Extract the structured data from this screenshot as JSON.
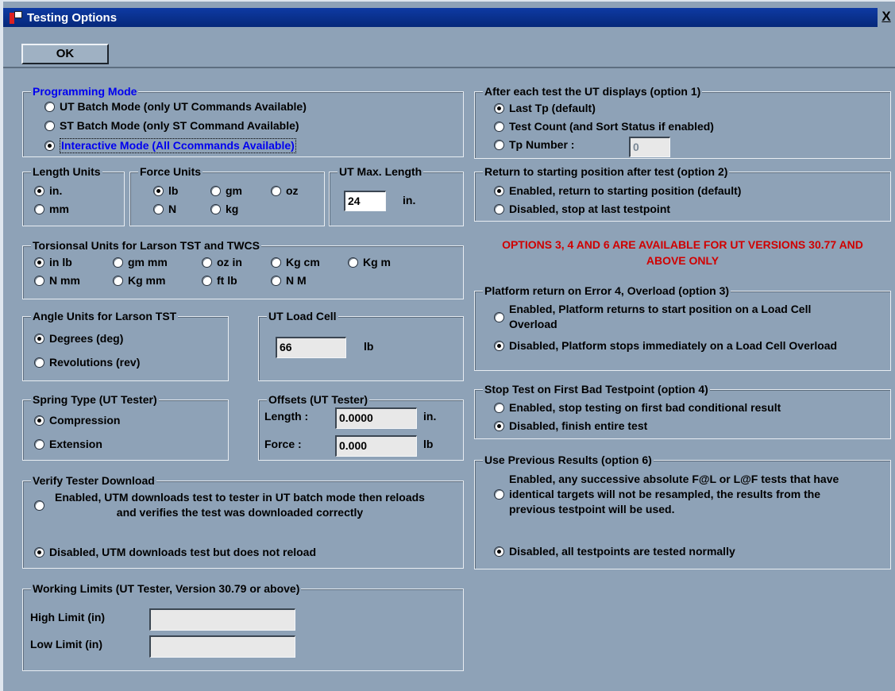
{
  "window": {
    "title": "Testing Options",
    "close_label": "X"
  },
  "toolbar": {
    "ok_label": "OK"
  },
  "programming_mode": {
    "label": "Programming Mode",
    "options": [
      "UT Batch Mode (only UT Commands Available)",
      "ST Batch Mode (only ST Command Available)",
      "Interactive Mode (All Ccommands Available)"
    ],
    "selected": 2
  },
  "length_units": {
    "label": "Length Units",
    "options": [
      "in.",
      "mm"
    ],
    "selected": 0
  },
  "force_units": {
    "label": "Force Units",
    "options": [
      "lb",
      "gm",
      "oz",
      "N",
      "kg"
    ],
    "selected": 0
  },
  "ut_max_length": {
    "label": "UT Max. Length",
    "value": "24",
    "unit": "in."
  },
  "torsional_units": {
    "label": "Torsionsal Units for Larson TST and TWCS",
    "options": [
      "in lb",
      "gm mm",
      "oz in",
      "Kg cm",
      "Kg m",
      "N mm",
      "Kg mm",
      "ft lb",
      "N M"
    ],
    "selected": 0
  },
  "angle_units": {
    "label": "Angle Units for Larson TST",
    "options": [
      "Degrees (deg)",
      "Revolutions (rev)"
    ],
    "selected": 0
  },
  "ut_load_cell": {
    "label": "UT Load Cell",
    "value": "66",
    "unit": "lb"
  },
  "spring_type": {
    "label": "Spring Type (UT Tester)",
    "options": [
      "Compression",
      "Extension"
    ],
    "selected": 0
  },
  "offsets": {
    "label": "Offsets (UT Tester)",
    "length_label": "Length :",
    "length_value": "0.0000",
    "length_unit": "in.",
    "force_label": "Force :",
    "force_value": "0.000",
    "force_unit": "lb"
  },
  "verify_download": {
    "label": "Verify Tester Download",
    "options": [
      "Enabled, UTM downloads test to tester in UT batch mode then reloads and verifies the test was downloaded correctly",
      "Disabled, UTM downloads test but does not reload"
    ],
    "selected": 1
  },
  "working_limits": {
    "label": "Working Limits (UT Tester, Version 30.79 or above)",
    "high_label": "High Limit (in)",
    "high_value": "",
    "low_label": "Low Limit (in)",
    "low_value": ""
  },
  "after_test": {
    "label": "After each test the UT displays (option 1)",
    "options": [
      "Last Tp (default)",
      "Test Count (and Sort Status if enabled)",
      "Tp Number :"
    ],
    "selected": 0,
    "tp_number_value": "0"
  },
  "return_start": {
    "label": "Return to starting position after test (option 2)",
    "options": [
      "Enabled, return to starting position (default)",
      "Disabled, stop at last testpoint"
    ],
    "selected": 0
  },
  "version_notice": "OPTIONS 3, 4 AND 6 ARE AVAILABLE FOR UT VERSIONS 30.77 AND ABOVE ONLY",
  "platform_return": {
    "label": "Platform return on Error 4, Overload (option 3)",
    "options": [
      "Enabled, Platform returns to start position on a Load Cell Overload",
      "Disabled, Platform stops immediately on a Load Cell Overload"
    ],
    "selected": 1
  },
  "stop_first_bad": {
    "label": "Stop Test on First Bad Testpoint (option 4)",
    "options": [
      "Enabled, stop testing on first bad conditional result",
      "Disabled, finish entire test"
    ],
    "selected": 1
  },
  "previous_results": {
    "label": "Use Previous Results (option 6)",
    "options": [
      "Enabled, any successive absolute F@L or L@F tests that have identical targets will not be resampled, the results from the previous testpoint will be used.",
      "Disabled, all testpoints are tested normally"
    ],
    "selected": 1
  },
  "colors": {
    "background": "#8ea2b7",
    "titlebar": "#0a2f8c",
    "legend_blue": "#0000f0",
    "notice_red": "#d00000"
  }
}
